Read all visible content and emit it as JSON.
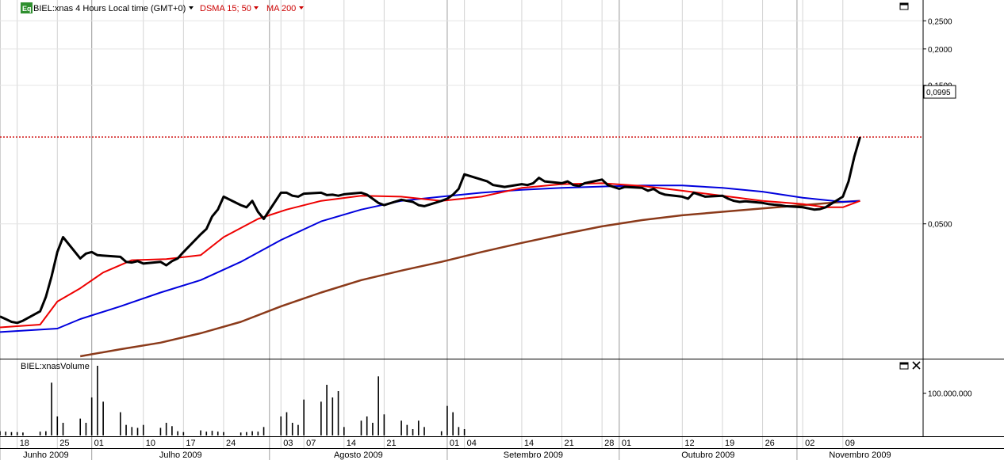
{
  "header": {
    "badge": "Eq",
    "symbol_label": "BIEL:xnas 4 Hours Local time (GMT+0)",
    "indicator_1": "DSMA 15; 50",
    "indicator_2": "MA 200"
  },
  "volume_panel": {
    "label": "BIEL:xnasVolume"
  },
  "price_axis": {
    "scale": "log",
    "ticks": [
      "0,2500",
      "0,2000",
      "0,1500",
      "0,0995",
      "0,0500"
    ],
    "last_price_label": "0,0995",
    "last_price": 0.0995
  },
  "volume_axis": {
    "ticks": [
      "100.000.000"
    ]
  },
  "time_axis": {
    "day_labels": [
      "18",
      "25",
      "01",
      "10",
      "17",
      "24",
      "03",
      "07",
      "14",
      "21",
      "01",
      "04",
      "14",
      "21",
      "28",
      "01",
      "12",
      "19",
      "26",
      "02",
      "09"
    ],
    "month_labels": [
      "Junho 2009",
      "Julho 2009",
      "Agosto 2009",
      "Setembro 2009",
      "Outubro 2009",
      "Novembro 2009"
    ]
  },
  "colors": {
    "price": "#000000",
    "dsma_fast": "#ee0000",
    "dsma_slow": "#0000dd",
    "ma200": "#8b3a1a",
    "grid": "#c8c8c8",
    "last_price_line": "#cc0000"
  },
  "chart_data": {
    "type": "line",
    "title": "BIEL:xnas 4 Hours Local time (GMT+0)",
    "yscale": "log",
    "ylim": [
      0.0175,
      0.27
    ],
    "x_range": [
      "2009-06-15",
      "2009-11-23"
    ],
    "series": [
      {
        "name": "BIEL:xnas",
        "points": [
          [
            "2009-06-15",
            0.024
          ],
          [
            "2009-06-16",
            0.0235
          ],
          [
            "2009-06-17",
            0.023
          ],
          [
            "2009-06-18",
            0.0228
          ],
          [
            "2009-06-19",
            0.0232
          ],
          [
            "2009-06-22",
            0.025
          ],
          [
            "2009-06-23",
            0.028
          ],
          [
            "2009-06-24",
            0.033
          ],
          [
            "2009-06-25",
            0.04
          ],
          [
            "2009-06-26",
            0.045
          ],
          [
            "2009-06-29",
            0.038
          ],
          [
            "2009-06-30",
            0.0395
          ],
          [
            "2009-07-01",
            0.04
          ],
          [
            "2009-07-02",
            0.039
          ],
          [
            "2009-07-06",
            0.0385
          ],
          [
            "2009-07-07",
            0.037
          ],
          [
            "2009-07-08",
            0.0368
          ],
          [
            "2009-07-09",
            0.0372
          ],
          [
            "2009-07-10",
            0.0365
          ],
          [
            "2009-07-13",
            0.037
          ],
          [
            "2009-07-14",
            0.036
          ],
          [
            "2009-07-15",
            0.0372
          ],
          [
            "2009-07-16",
            0.038
          ],
          [
            "2009-07-17",
            0.04
          ],
          [
            "2009-07-20",
            0.046
          ],
          [
            "2009-07-21",
            0.048
          ],
          [
            "2009-07-22",
            0.053
          ],
          [
            "2009-07-23",
            0.056
          ],
          [
            "2009-07-24",
            0.062
          ],
          [
            "2009-07-27",
            0.058
          ],
          [
            "2009-07-28",
            0.057
          ],
          [
            "2009-07-29",
            0.06
          ],
          [
            "2009-07-30",
            0.055
          ],
          [
            "2009-07-31",
            0.052
          ],
          [
            "2009-08-03",
            0.064
          ],
          [
            "2009-08-04",
            0.064
          ],
          [
            "2009-08-05",
            0.0625
          ],
          [
            "2009-08-06",
            0.062
          ],
          [
            "2009-08-07",
            0.0635
          ],
          [
            "2009-08-10",
            0.064
          ],
          [
            "2009-08-11",
            0.0628
          ],
          [
            "2009-08-12",
            0.063
          ],
          [
            "2009-08-13",
            0.0625
          ],
          [
            "2009-08-14",
            0.0632
          ],
          [
            "2009-08-17",
            0.064
          ],
          [
            "2009-08-18",
            0.063
          ],
          [
            "2009-08-19",
            0.061
          ],
          [
            "2009-08-20",
            0.059
          ],
          [
            "2009-08-21",
            0.058
          ],
          [
            "2009-08-24",
            0.0605
          ],
          [
            "2009-08-25",
            0.06
          ],
          [
            "2009-08-26",
            0.0595
          ],
          [
            "2009-08-27",
            0.058
          ],
          [
            "2009-08-28",
            0.0575
          ],
          [
            "2009-08-31",
            0.06
          ],
          [
            "2009-09-01",
            0.061
          ],
          [
            "2009-09-02",
            0.063
          ],
          [
            "2009-09-03",
            0.066
          ],
          [
            "2009-09-04",
            0.074
          ],
          [
            "2009-09-08",
            0.07
          ],
          [
            "2009-09-09",
            0.068
          ],
          [
            "2009-09-10",
            0.0675
          ],
          [
            "2009-09-11",
            0.067
          ],
          [
            "2009-09-14",
            0.0685
          ],
          [
            "2009-09-15",
            0.068
          ],
          [
            "2009-09-16",
            0.069
          ],
          [
            "2009-09-17",
            0.072
          ],
          [
            "2009-09-18",
            0.07
          ],
          [
            "2009-09-21",
            0.069
          ],
          [
            "2009-09-22",
            0.07
          ],
          [
            "2009-09-23",
            0.068
          ],
          [
            "2009-09-24",
            0.0675
          ],
          [
            "2009-09-25",
            0.069
          ],
          [
            "2009-09-28",
            0.071
          ],
          [
            "2009-09-29",
            0.068
          ],
          [
            "2009-09-30",
            0.067
          ],
          [
            "2009-10-01",
            0.066
          ],
          [
            "2009-10-02",
            0.067
          ],
          [
            "2009-10-05",
            0.0665
          ],
          [
            "2009-10-06",
            0.065
          ],
          [
            "2009-10-07",
            0.066
          ],
          [
            "2009-10-08",
            0.064
          ],
          [
            "2009-10-09",
            0.063
          ],
          [
            "2009-10-12",
            0.062
          ],
          [
            "2009-10-13",
            0.061
          ],
          [
            "2009-10-14",
            0.064
          ],
          [
            "2009-10-15",
            0.063
          ],
          [
            "2009-10-16",
            0.062
          ],
          [
            "2009-10-19",
            0.0625
          ],
          [
            "2009-10-20",
            0.061
          ],
          [
            "2009-10-21",
            0.06
          ],
          [
            "2009-10-22",
            0.0595
          ],
          [
            "2009-10-23",
            0.0598
          ],
          [
            "2009-10-26",
            0.059
          ],
          [
            "2009-10-27",
            0.0585
          ],
          [
            "2009-10-28",
            0.0582
          ],
          [
            "2009-10-29",
            0.058
          ],
          [
            "2009-10-30",
            0.0575
          ],
          [
            "2009-11-02",
            0.057
          ],
          [
            "2009-11-03",
            0.0565
          ],
          [
            "2009-11-04",
            0.056
          ],
          [
            "2009-11-05",
            0.0562
          ],
          [
            "2009-11-06",
            0.057
          ],
          [
            "2009-11-09",
            0.062
          ],
          [
            "2009-11-10",
            0.07
          ],
          [
            "2009-11-11",
            0.085
          ],
          [
            "2009-11-12",
            0.0995
          ]
        ]
      },
      {
        "name": "DSMA 15",
        "points": [
          [
            "2009-06-15",
            0.022
          ],
          [
            "2009-06-22",
            0.0225
          ],
          [
            "2009-06-25",
            0.027
          ],
          [
            "2009-06-29",
            0.03
          ],
          [
            "2009-07-03",
            0.034
          ],
          [
            "2009-07-08",
            0.0375
          ],
          [
            "2009-07-14",
            0.0378
          ],
          [
            "2009-07-20",
            0.039
          ],
          [
            "2009-07-24",
            0.045
          ],
          [
            "2009-07-30",
            0.052
          ],
          [
            "2009-08-04",
            0.056
          ],
          [
            "2009-08-10",
            0.06
          ],
          [
            "2009-08-17",
            0.0625
          ],
          [
            "2009-08-24",
            0.062
          ],
          [
            "2009-08-31",
            0.06
          ],
          [
            "2009-09-07",
            0.062
          ],
          [
            "2009-09-14",
            0.0665
          ],
          [
            "2009-09-21",
            0.0685
          ],
          [
            "2009-09-28",
            0.069
          ],
          [
            "2009-10-05",
            0.0675
          ],
          [
            "2009-10-12",
            0.065
          ],
          [
            "2009-10-19",
            0.0625
          ],
          [
            "2009-10-26",
            0.06
          ],
          [
            "2009-11-02",
            0.0585
          ],
          [
            "2009-11-06",
            0.057
          ],
          [
            "2009-11-09",
            0.057
          ],
          [
            "2009-11-12",
            0.06
          ]
        ]
      },
      {
        "name": "DSMA 50",
        "points": [
          [
            "2009-06-15",
            0.0212
          ],
          [
            "2009-06-25",
            0.0218
          ],
          [
            "2009-06-29",
            0.0235
          ],
          [
            "2009-07-06",
            0.026
          ],
          [
            "2009-07-13",
            0.029
          ],
          [
            "2009-07-20",
            0.032
          ],
          [
            "2009-07-27",
            0.037
          ],
          [
            "2009-08-03",
            0.044
          ],
          [
            "2009-08-10",
            0.051
          ],
          [
            "2009-08-17",
            0.056
          ],
          [
            "2009-08-24",
            0.06
          ],
          [
            "2009-08-31",
            0.062
          ],
          [
            "2009-09-07",
            0.064
          ],
          [
            "2009-09-14",
            0.0655
          ],
          [
            "2009-09-21",
            0.0665
          ],
          [
            "2009-09-28",
            0.0672
          ],
          [
            "2009-10-05",
            0.0678
          ],
          [
            "2009-10-12",
            0.0678
          ],
          [
            "2009-10-19",
            0.0665
          ],
          [
            "2009-10-26",
            0.0645
          ],
          [
            "2009-11-02",
            0.0615
          ],
          [
            "2009-11-09",
            0.0595
          ],
          [
            "2009-11-12",
            0.06
          ]
        ]
      },
      {
        "name": "MA 200",
        "points": [
          [
            "2009-06-29",
            0.0175
          ],
          [
            "2009-07-06",
            0.0185
          ],
          [
            "2009-07-13",
            0.0195
          ],
          [
            "2009-07-20",
            0.021
          ],
          [
            "2009-07-27",
            0.023
          ],
          [
            "2009-08-03",
            0.026
          ],
          [
            "2009-08-10",
            0.029
          ],
          [
            "2009-08-17",
            0.032
          ],
          [
            "2009-08-24",
            0.0345
          ],
          [
            "2009-08-31",
            0.037
          ],
          [
            "2009-09-07",
            0.04
          ],
          [
            "2009-09-14",
            0.043
          ],
          [
            "2009-09-21",
            0.046
          ],
          [
            "2009-09-28",
            0.049
          ],
          [
            "2009-10-05",
            0.0515
          ],
          [
            "2009-10-12",
            0.0535
          ],
          [
            "2009-10-19",
            0.055
          ],
          [
            "2009-10-26",
            0.0565
          ],
          [
            "2009-11-02",
            0.058
          ],
          [
            "2009-11-09",
            0.0595
          ],
          [
            "2009-11-12",
            0.06
          ]
        ]
      }
    ],
    "volume": {
      "name": "Volume",
      "ylim": [
        0,
        165000000
      ],
      "points": [
        [
          "2009-06-15",
          10000000
        ],
        [
          "2009-06-16",
          9000000
        ],
        [
          "2009-06-17",
          8000000
        ],
        [
          "2009-06-18",
          8000000
        ],
        [
          "2009-06-19",
          7000000
        ],
        [
          "2009-06-22",
          9000000
        ],
        [
          "2009-06-23",
          10000000
        ],
        [
          "2009-06-24",
          125000000
        ],
        [
          "2009-06-25",
          45000000
        ],
        [
          "2009-06-26",
          30000000
        ],
        [
          "2009-06-29",
          40000000
        ],
        [
          "2009-06-30",
          30000000
        ],
        [
          "2009-07-01",
          90000000
        ],
        [
          "2009-07-02",
          165000000
        ],
        [
          "2009-07-03",
          80000000
        ],
        [
          "2009-07-06",
          55000000
        ],
        [
          "2009-07-07",
          25000000
        ],
        [
          "2009-07-08",
          20000000
        ],
        [
          "2009-07-09",
          18000000
        ],
        [
          "2009-07-10",
          25000000
        ],
        [
          "2009-07-13",
          18000000
        ],
        [
          "2009-07-14",
          30000000
        ],
        [
          "2009-07-15",
          22000000
        ],
        [
          "2009-07-16",
          10000000
        ],
        [
          "2009-07-17",
          8000000
        ],
        [
          "2009-07-20",
          12000000
        ],
        [
          "2009-07-21",
          9000000
        ],
        [
          "2009-07-22",
          11000000
        ],
        [
          "2009-07-23",
          9000000
        ],
        [
          "2009-07-24",
          8000000
        ],
        [
          "2009-07-27",
          7000000
        ],
        [
          "2009-07-28",
          8000000
        ],
        [
          "2009-07-29",
          10000000
        ],
        [
          "2009-07-30",
          9000000
        ],
        [
          "2009-07-31",
          20000000
        ],
        [
          "2009-08-03",
          45000000
        ],
        [
          "2009-08-04",
          55000000
        ],
        [
          "2009-08-05",
          30000000
        ],
        [
          "2009-08-06",
          25000000
        ],
        [
          "2009-08-07",
          85000000
        ],
        [
          "2009-08-10",
          80000000
        ],
        [
          "2009-08-11",
          120000000
        ],
        [
          "2009-08-12",
          90000000
        ],
        [
          "2009-08-13",
          105000000
        ],
        [
          "2009-08-14",
          20000000
        ],
        [
          "2009-08-17",
          35000000
        ],
        [
          "2009-08-18",
          45000000
        ],
        [
          "2009-08-19",
          30000000
        ],
        [
          "2009-08-20",
          140000000
        ],
        [
          "2009-08-21",
          50000000
        ],
        [
          "2009-08-24",
          35000000
        ],
        [
          "2009-08-25",
          25000000
        ],
        [
          "2009-08-26",
          15000000
        ],
        [
          "2009-08-27",
          35000000
        ],
        [
          "2009-08-28",
          20000000
        ],
        [
          "2009-08-31",
          10000000
        ],
        [
          "2009-09-01",
          70000000
        ],
        [
          "2009-09-02",
          55000000
        ],
        [
          "2009-09-03",
          20000000
        ],
        [
          "2009-09-04",
          15000000
        ]
      ]
    }
  }
}
